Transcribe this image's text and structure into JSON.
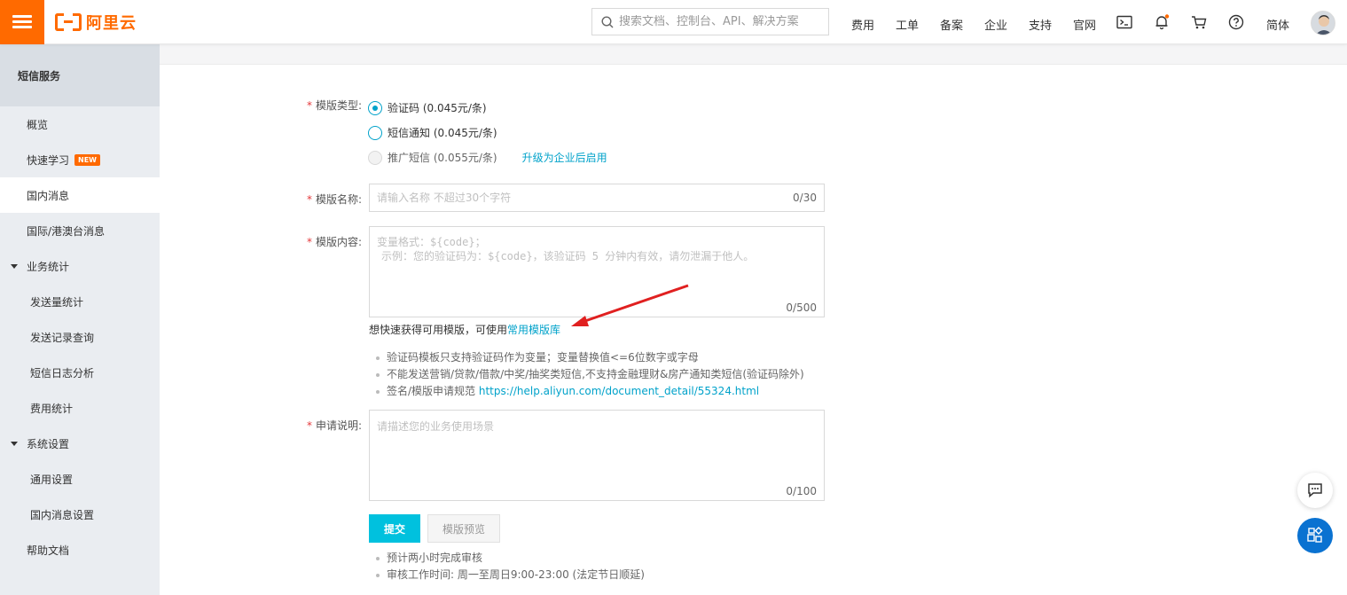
{
  "topbar": {
    "logo_text": "阿里云",
    "search_placeholder": "搜索文档、控制台、API、解决方案",
    "nav": [
      "费用",
      "工单",
      "备案",
      "企业",
      "支持",
      "官网"
    ],
    "lang": "简体",
    "icons": [
      "terminal-icon",
      "bell-icon",
      "cart-icon",
      "help-icon"
    ]
  },
  "sidebar": {
    "title": "短信服务",
    "items": [
      {
        "label": "概览"
      },
      {
        "label": "快速学习",
        "badge": "NEW"
      },
      {
        "label": "国内消息",
        "active": true
      },
      {
        "label": "国际/港澳台消息"
      }
    ],
    "group1": {
      "label": "业务统计",
      "items": [
        "发送量统计",
        "发送记录查询",
        "短信日志分析",
        "费用统计"
      ]
    },
    "group2": {
      "label": "系统设置",
      "items": [
        "通用设置",
        "国内消息设置"
      ]
    },
    "help": "帮助文档"
  },
  "form": {
    "type_label": "模版类型:",
    "options": [
      {
        "label": "验证码 (0.045元/条)",
        "checked": true
      },
      {
        "label": "短信通知 (0.045元/条)",
        "checked": false
      },
      {
        "label": "推广短信 (0.055元/条)",
        "disabled": true
      }
    ],
    "upgrade_link": "升级为企业后启用",
    "name_label": "模版名称:",
    "name_placeholder": "请输入名称 不超过30个字符",
    "name_counter": "0/30",
    "content_label": "模版内容:",
    "content_placeholder_line1": "变量格式：${code}；",
    "content_placeholder_line2": "示例：您的验证码为：${code}，该验证码 5 分钟内有效，请勿泄漏于他人。",
    "content_counter": "0/500",
    "quick_prefix": "想快速获得可用模版，可使用",
    "quick_link": "常用模版库",
    "tips": [
      "验证码模板只支持验证码作为变量；变量替换值<=6位数字或字母",
      "不能发送营销/贷款/借款/中奖/抽奖类短信,不支持金融理财&房产通知类短信(验证码除外)"
    ],
    "tip3_prefix": "签名/模版申请规范",
    "tip3_link": "https://help.aliyun.com/document_detail/55324.html",
    "desc_label": "申请说明:",
    "desc_placeholder": "请描述您的业务使用场景",
    "desc_counter": "0/100",
    "submit": "提交",
    "preview": "模版预览",
    "bottom_tips": [
      "预计两小时完成审核",
      "审核工作时间: 周一至周日9:00-23:00  (法定节日顺延)"
    ]
  },
  "colors": {
    "brand": "#ff6a00",
    "accent": "#00c1de",
    "link": "#00a2ca",
    "arrow": "#e02020"
  }
}
